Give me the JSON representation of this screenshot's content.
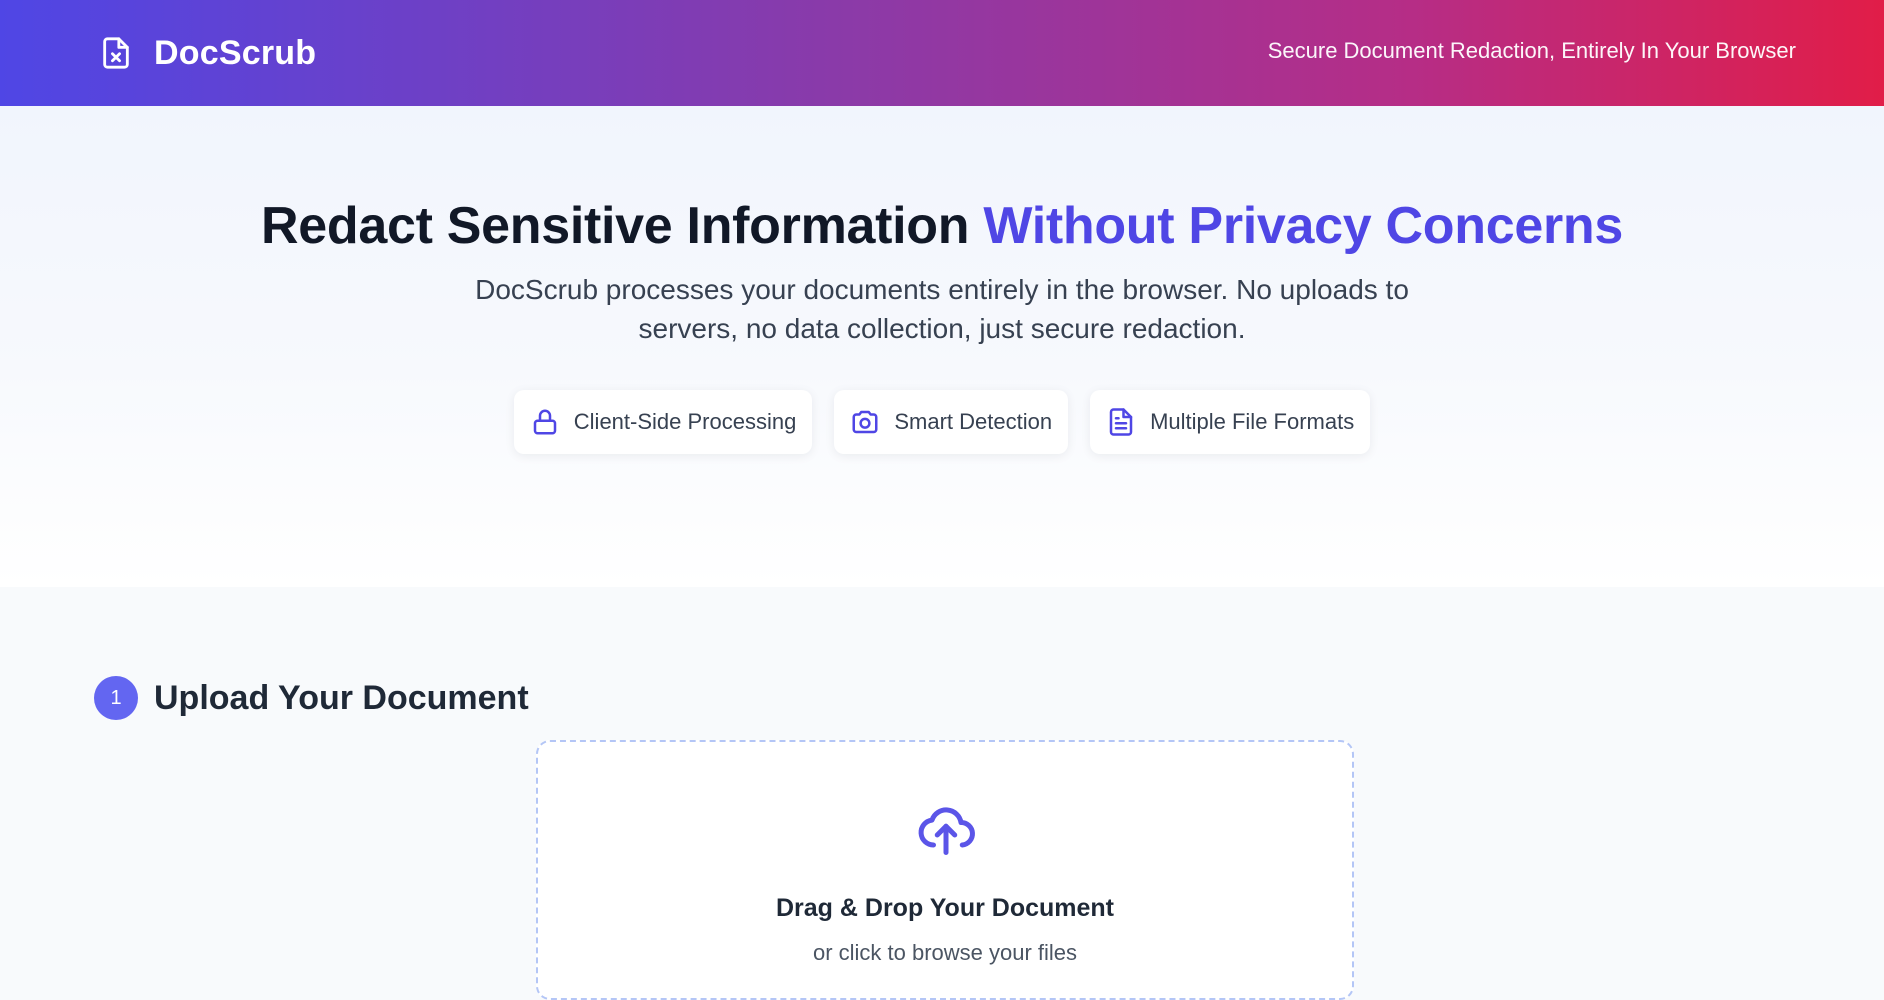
{
  "header": {
    "brand_name": "DocScrub",
    "brand_icon": "file-x-icon",
    "tagline": "Secure Document Redaction, Entirely In Your Browser"
  },
  "hero": {
    "title_part1": "Redact Sensitive Information ",
    "title_accent": "Without Privacy Concerns",
    "description": "DocScrub processes your documents entirely in the browser. No uploads to servers, no data collection, just secure redaction.",
    "features": [
      {
        "label": "Client-Side Processing",
        "icon": "lock-icon"
      },
      {
        "label": "Smart Detection",
        "icon": "camera-icon"
      },
      {
        "label": "Multiple File Formats",
        "icon": "document-icon"
      }
    ]
  },
  "upload": {
    "step_number": "1",
    "step_title": "Upload Your Document",
    "drop_title": "Drag & Drop Your Document",
    "drop_subtitle": "or click to browse your files",
    "icon": "cloud-upload-icon"
  },
  "colors": {
    "accent": "#4f46e5",
    "header_gradient_start": "#4f46e5",
    "header_gradient_end": "#e11d48",
    "step_badge": "#6366f1"
  }
}
